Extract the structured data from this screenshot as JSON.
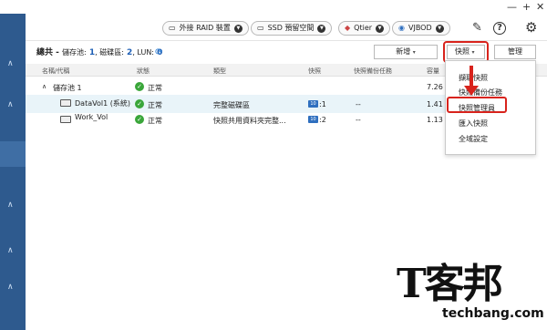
{
  "window": {
    "minimize": "—",
    "maximize": "+",
    "close": "✕"
  },
  "toolbar": {
    "external_raid": "外接 RAID 裝置",
    "ssd": "SSD 預留空間",
    "qtier": "Qtier",
    "vjbod": "VJBOD",
    "help_icon": "?",
    "settings_icon": "⚙"
  },
  "summary": {
    "label": "總共 -",
    "pool_label": "儲存池:",
    "pool_count": "1",
    "volume_label": ", 磁碟區:",
    "volume_count": "2",
    "lun_label": ", LUN:",
    "lun_count": "0"
  },
  "actions": {
    "new": "新增",
    "snapshot": "快照",
    "manage": "管理"
  },
  "table": {
    "headers": {
      "name": "名稱/代稱",
      "status": "狀態",
      "type": "類型",
      "snapshot": "快照",
      "backup": "快照備份任務",
      "capacity": "容量"
    },
    "rows": [
      {
        "name": "儲存池 1",
        "status": "正常",
        "type": "",
        "snapshot": "",
        "backup": "",
        "capacity": "7.26 T"
      },
      {
        "name": "DataVol1 (系統)",
        "status": "正常",
        "type": "完整磁碟區",
        "snapshot": ":1",
        "backup": "--",
        "capacity": "1.41 T"
      },
      {
        "name": "Work_Vol",
        "status": "正常",
        "type": "快照共用資料夾完整...",
        "snapshot": ":2",
        "backup": "--",
        "capacity": "1.13 T"
      }
    ]
  },
  "snapshot_menu": {
    "items": [
      "擷取快照",
      "快照備份任務",
      "快照管理員",
      "匯入快照",
      "全域設定"
    ],
    "highlighted": "快照管理員"
  },
  "watermark": {
    "logo": "T客邦",
    "url": "techbang.com"
  },
  "colors": {
    "accent": "#d8231c",
    "nav": "#2e5a8e",
    "ok": "#3aa63a"
  }
}
